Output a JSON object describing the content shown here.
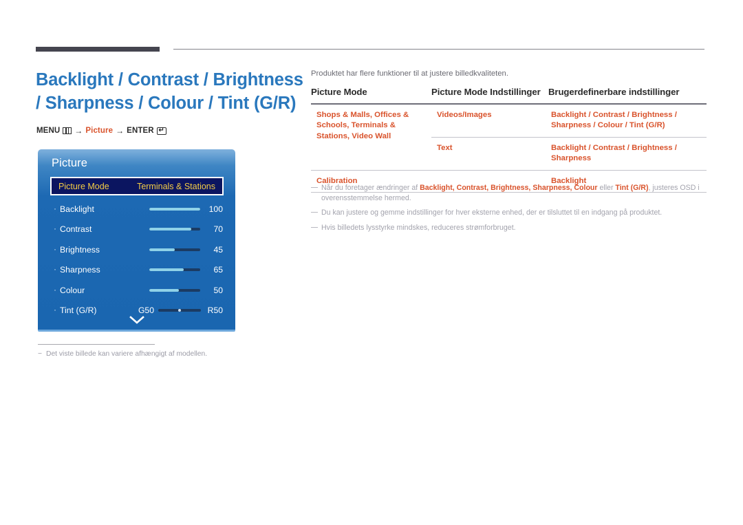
{
  "page": {
    "title": "Backlight / Contrast / Brightness / Sharpness / Colour / Tint (G/R)",
    "breadcrumb": {
      "menu_label": "MENU",
      "menu_icon": "menu-grid-icon",
      "arrow": "→",
      "path_label": "Picture",
      "enter_label": "ENTER",
      "enter_icon": "enter-key-icon",
      "enter_glyph": "↵"
    }
  },
  "osd": {
    "title": "Picture",
    "highlight": {
      "label": "Picture Mode",
      "value": "Terminals & Stations"
    },
    "items": [
      {
        "label": "Backlight",
        "value": "100",
        "fill_pct": 100
      },
      {
        "label": "Contrast",
        "value": "70",
        "fill_pct": 82
      },
      {
        "label": "Brightness",
        "value": "45",
        "fill_pct": 50
      },
      {
        "label": "Sharpness",
        "value": "65",
        "fill_pct": 68
      },
      {
        "label": "Colour",
        "value": "50",
        "fill_pct": 58
      }
    ],
    "tint": {
      "label": "Tint (G/R)",
      "left_end": "G50",
      "right_end": "R50",
      "knob_pct": 50
    },
    "scroll_down_icon": "chevron-down-icon",
    "footnote": {
      "dash": "−",
      "text": "Det viste billede kan variere afhængigt af modellen."
    }
  },
  "content": {
    "intro": "Produktet har flere funktioner til at justere billedkvaliteten.",
    "table": {
      "headers": [
        "Picture Mode",
        "Picture Mode Indstillinger",
        "Brugerdefinerbare indstillinger"
      ],
      "groups": [
        {
          "mode": "Shops & Malls, Offices & Schools, Terminals & Stations, Video Wall",
          "rows": [
            {
              "setting": "Videos/Images",
              "custom": "Backlight / Contrast / Brightness / Sharpness / Colour / Tint (G/R)"
            },
            {
              "setting": "Text",
              "custom": "Backlight / Contrast / Brightness / Sharpness"
            }
          ]
        },
        {
          "mode": "Calibration",
          "rows": [
            {
              "setting": "",
              "custom": "Backlight"
            }
          ]
        }
      ]
    },
    "notes": [
      {
        "pre": "Når du foretager ændringer af ",
        "bold": "Backlight, Contrast, Brightness, Sharpness, Colour",
        "mid": " eller ",
        "bold2": "Tint (G/R)",
        "post": ", justeres OSD i overensstemmelse hermed."
      },
      {
        "pre": "Du kan justere og gemme indstillinger for hver eksterne enhed, der er tilsluttet til en indgang på produktet.",
        "bold": "",
        "mid": "",
        "bold2": "",
        "post": ""
      },
      {
        "pre": "Hvis billedets lysstyrke mindskes, reduceres strømforbruget.",
        "bold": "",
        "mid": "",
        "bold2": "",
        "post": ""
      }
    ]
  },
  "colors": {
    "accent_blue": "#2a78bd",
    "accent_orange": "#d9532c",
    "osd_blue": "#1a66b0",
    "osd_highlight_bg": "#0b1560",
    "osd_highlight_text": "#f4cd45",
    "rule_dark": "#45454f"
  }
}
